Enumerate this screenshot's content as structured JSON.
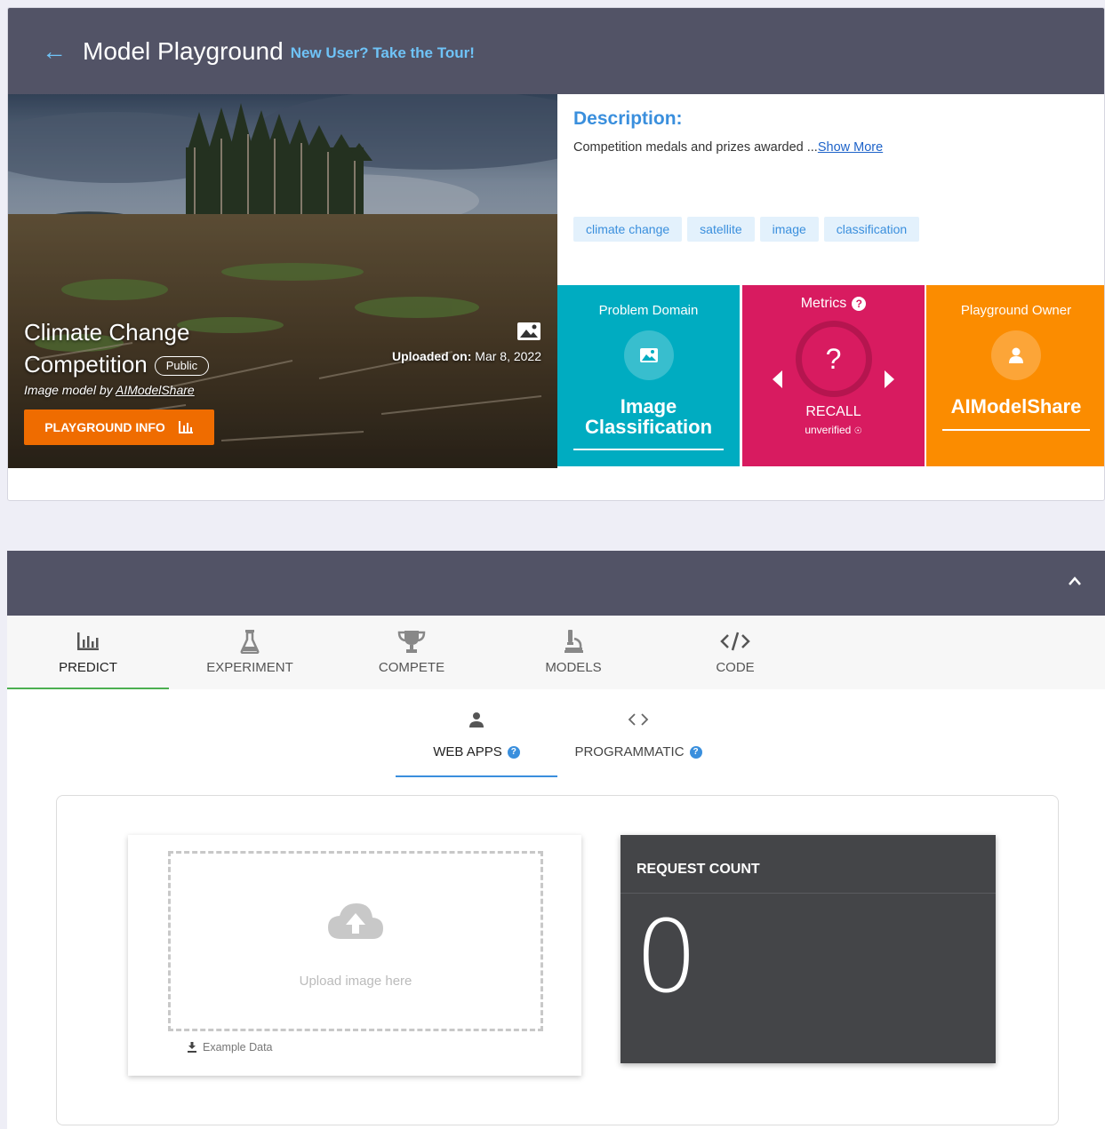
{
  "header": {
    "title": "Model Playground",
    "tour_link": "New User? Take the Tour!"
  },
  "hero": {
    "title_line1": "Climate Change",
    "title_line2": "Competition",
    "visibility_badge": "Public",
    "subtitle_prefix": "Image model by ",
    "subtitle_owner": "AIModelShare",
    "info_button": "PLAYGROUND INFO",
    "uploaded_label": "Uploaded on:",
    "uploaded_date": "Mar 8, 2022"
  },
  "description": {
    "title": "Description:",
    "text": "Competition medals and prizes awarded ...",
    "show_more": "Show More",
    "tags": [
      "climate change",
      "satellite",
      "image",
      "classification"
    ]
  },
  "tiles": {
    "domain_label": "Problem Domain",
    "domain_value_line1": "Image",
    "domain_value_line2": "Classification",
    "metrics_label": "Metrics",
    "metrics_value": "?",
    "metrics_name": "RECALL",
    "metrics_status": "unverified",
    "owner_label": "Playground Owner",
    "owner_value": "AIModelShare"
  },
  "tabs": [
    "PREDICT",
    "EXPERIMENT",
    "COMPETE",
    "MODELS",
    "CODE"
  ],
  "subtabs": [
    "WEB APPS",
    "PROGRAMMATIC"
  ],
  "upload": {
    "hint": "Upload image here",
    "example": "Example Data"
  },
  "request": {
    "title": "REQUEST COUNT",
    "count": "0"
  },
  "colors": {
    "header_bg": "#525366",
    "accent_blue": "#3a8fdd",
    "domain_tile": "#00acc1",
    "metrics_tile": "#d81b60",
    "owner_tile": "#fb8c00",
    "info_button": "#ef6c00",
    "request_card": "#444548"
  },
  "icons": {
    "back": "arrow-left-icon",
    "chart": "bar-chart-icon",
    "image": "image-icon",
    "person": "person-icon",
    "flask": "flask-icon",
    "trophy": "trophy-icon",
    "microscope": "microscope-icon",
    "code": "code-icon",
    "cloud_upload": "cloud-upload-icon",
    "download": "download-icon",
    "chevron_up": "chevron-up-icon",
    "help": "help-circle-icon"
  }
}
